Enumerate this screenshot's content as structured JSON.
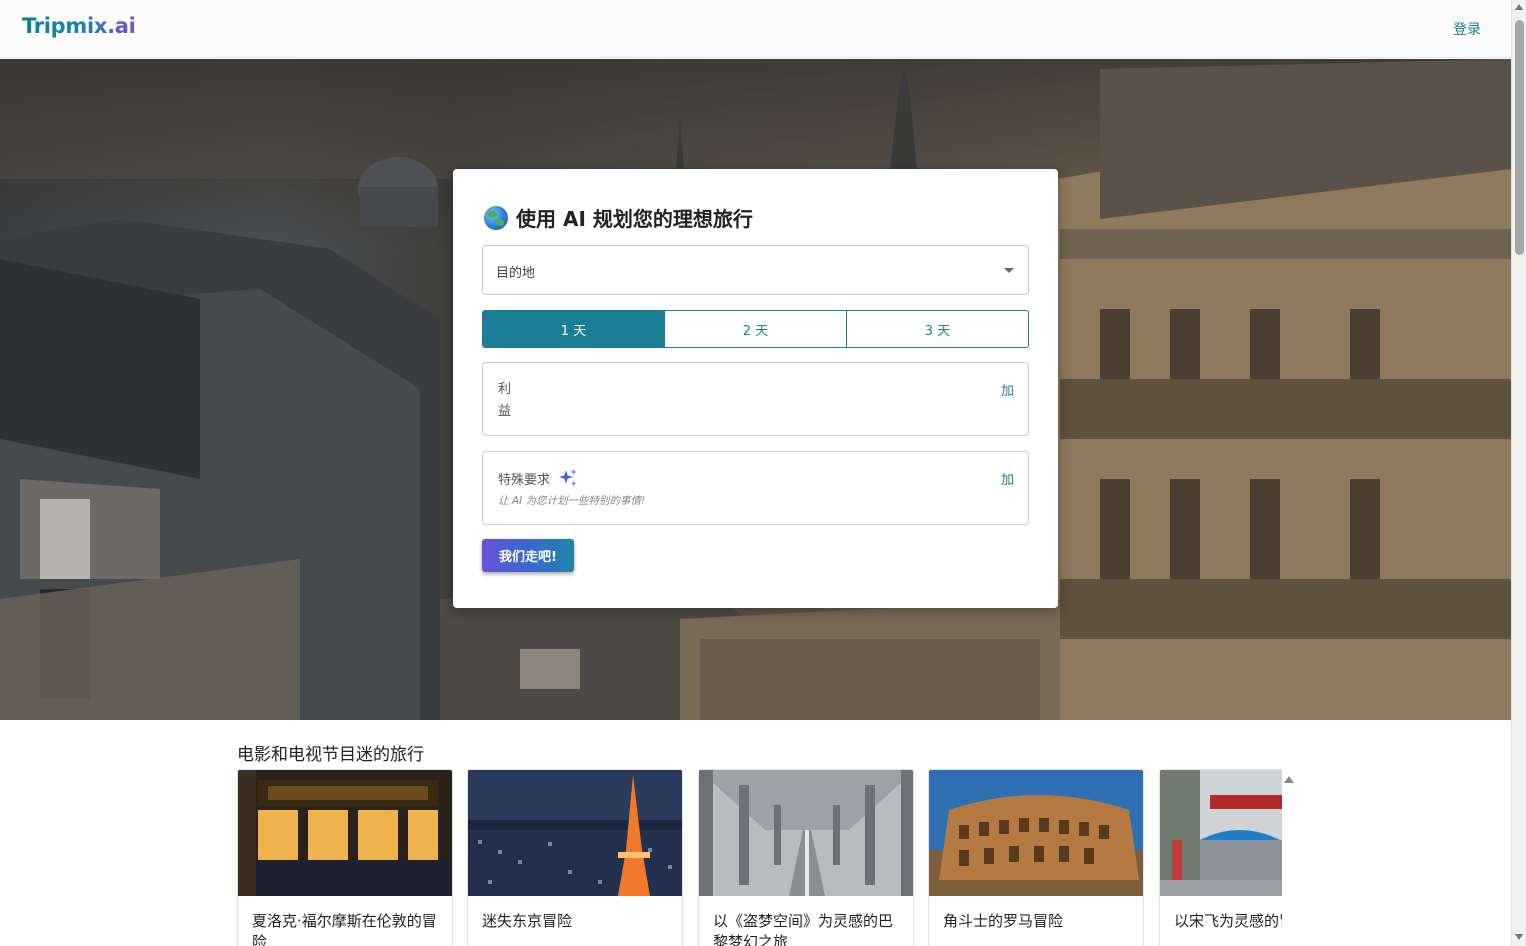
{
  "header": {
    "logo": "Tripmix.ai",
    "login_label": "登录"
  },
  "planner": {
    "title": "使用 AI 规划您的理想旅行",
    "title_icon": "globe-icon",
    "destination_label": "目的地",
    "days": [
      {
        "label": "1 天",
        "selected": true
      },
      {
        "label": "2 天",
        "selected": false
      },
      {
        "label": "3 天",
        "selected": false
      }
    ],
    "interests_label_line1": "利",
    "interests_label_line2": "益",
    "interests_add": "加",
    "special_label": "特殊要求",
    "special_hint": "让 AI 为您计划一些特别的事情!",
    "special_add": "加",
    "go_label": "我们走吧!"
  },
  "section": {
    "title": "电影和电视节目迷的旅行",
    "tiles": [
      {
        "title": "夏洛克·福尔摩斯在伦敦的冒险",
        "image": "sherlock-holmes-pub"
      },
      {
        "title": "迷失东京冒险",
        "image": "tokyo-tower-night"
      },
      {
        "title": "以《盗梦空间》为灵感的巴黎梦幻之旅",
        "image": "bir-hakeim-bridge"
      },
      {
        "title": "角斗士的罗马冒险",
        "image": "colosseum"
      },
      {
        "title": "以宋飞为灵感的冒险",
        "image": "toms-restaurant"
      }
    ]
  },
  "colors": {
    "accent": "#1a7f96",
    "button_gradient_start": "#6a52d9",
    "button_gradient_end": "#1f86a8"
  }
}
